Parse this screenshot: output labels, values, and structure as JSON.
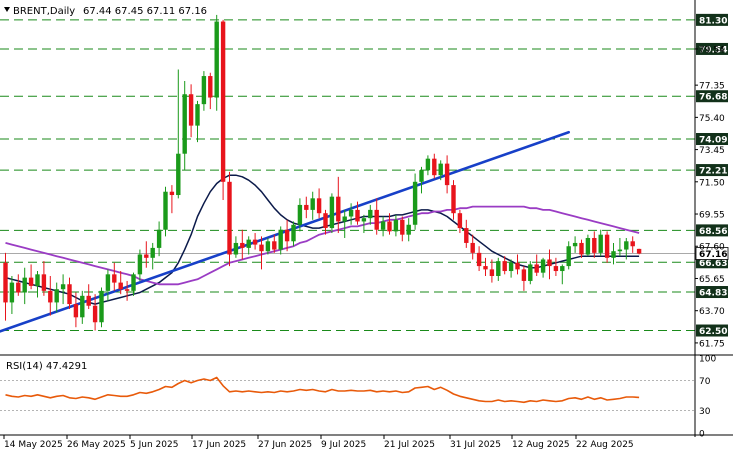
{
  "header": {
    "symbol": "BRENT,Daily",
    "ohlc": "67.44 67.45 67.11 67.16"
  },
  "rsi_header": {
    "label": "RSI(14) 47.4291"
  },
  "colors": {
    "bull": "#1a9a1a",
    "bear": "#e8141c",
    "fast_ma": "#0b1a4a",
    "slow_ma": "#9a3cc4",
    "trendline": "#1740c8",
    "rsi": "#e85a0a",
    "level_line": "#1a8a1a",
    "badge": "#12311a"
  },
  "chart_data": {
    "type": "candlestick",
    "ylim": [
      61.2,
      82.2
    ],
    "price_ticks": [
      "79.54",
      "77.35",
      "75.40",
      "73.45",
      "71.50",
      "69.55",
      "67.60",
      "65.65",
      "63.70",
      "61.75"
    ],
    "level_badges": [
      "81.30",
      "79.54",
      "76.68",
      "74.09",
      "72.21",
      "68.56",
      "66.63",
      "64.83",
      "62.50"
    ],
    "current_price": "67.16",
    "x_labels": [
      "14 May 2025",
      "26 May 2025",
      "5 Jun 2025",
      "17 Jun 2025",
      "27 Jun 2025",
      "9 Jul 2025",
      "21 Jul 2025",
      "31 Jul 2025",
      "12 Aug 2025",
      "22 Aug 2025"
    ],
    "candles": [
      [
        66.6,
        67.2,
        63.1,
        64.2
      ],
      [
        64.2,
        65.8,
        63.5,
        65.4
      ],
      [
        65.4,
        65.9,
        64.6,
        64.8
      ],
      [
        64.8,
        66.3,
        64.1,
        65.7
      ],
      [
        65.7,
        66.5,
        65.0,
        65.2
      ],
      [
        65.2,
        66.1,
        64.5,
        65.9
      ],
      [
        65.9,
        66.7,
        64.6,
        64.9
      ],
      [
        64.9,
        65.8,
        63.4,
        64.2
      ],
      [
        64.2,
        65.4,
        63.6,
        65.0
      ],
      [
        65.0,
        65.9,
        64.1,
        65.3
      ],
      [
        65.3,
        65.7,
        63.8,
        64.1
      ],
      [
        64.1,
        64.8,
        62.7,
        63.3
      ],
      [
        63.3,
        64.9,
        62.9,
        64.6
      ],
      [
        64.6,
        65.3,
        63.8,
        64.0
      ],
      [
        64.0,
        64.7,
        62.5,
        63.0
      ],
      [
        63.0,
        65.1,
        62.7,
        64.9
      ],
      [
        64.9,
        66.2,
        64.3,
        65.9
      ],
      [
        65.9,
        66.6,
        64.9,
        65.4
      ],
      [
        65.4,
        66.1,
        64.7,
        65.0
      ],
      [
        65.0,
        65.5,
        64.3,
        64.9
      ],
      [
        64.9,
        66.0,
        64.6,
        65.9
      ],
      [
        65.9,
        67.4,
        65.5,
        67.1
      ],
      [
        67.1,
        67.9,
        66.3,
        66.9
      ],
      [
        66.9,
        67.8,
        66.2,
        67.5
      ],
      [
        67.5,
        69.1,
        67.0,
        68.6
      ],
      [
        68.6,
        71.2,
        68.2,
        70.9
      ],
      [
        70.9,
        71.3,
        69.6,
        70.7
      ],
      [
        70.7,
        78.3,
        70.5,
        73.2
      ],
      [
        73.2,
        77.6,
        72.2,
        76.8
      ],
      [
        76.8,
        77.4,
        74.2,
        74.9
      ],
      [
        74.9,
        76.4,
        73.9,
        76.2
      ],
      [
        76.2,
        78.2,
        75.8,
        77.9
      ],
      [
        77.9,
        78.1,
        75.9,
        76.6
      ],
      [
        76.6,
        81.6,
        75.8,
        81.2
      ],
      [
        81.2,
        81.3,
        70.4,
        71.5
      ],
      [
        71.5,
        72.1,
        66.4,
        67.1
      ],
      [
        67.1,
        68.2,
        66.9,
        67.8
      ],
      [
        67.8,
        68.6,
        66.8,
        67.5
      ],
      [
        67.5,
        68.2,
        67.1,
        68.0
      ],
      [
        68.0,
        68.4,
        67.4,
        67.7
      ],
      [
        67.7,
        68.2,
        66.2,
        67.3
      ],
      [
        67.3,
        68.1,
        67.1,
        67.9
      ],
      [
        67.9,
        68.3,
        67.2,
        67.4
      ],
      [
        67.4,
        68.8,
        67.1,
        68.6
      ],
      [
        68.6,
        69.2,
        67.3,
        67.9
      ],
      [
        67.9,
        69.1,
        67.6,
        68.9
      ],
      [
        68.9,
        70.5,
        68.5,
        70.1
      ],
      [
        70.1,
        70.6,
        69.3,
        69.8
      ],
      [
        69.8,
        70.9,
        69.2,
        70.5
      ],
      [
        70.5,
        71.1,
        69.3,
        69.6
      ],
      [
        69.6,
        69.8,
        68.3,
        68.7
      ],
      [
        68.7,
        70.8,
        68.4,
        70.6
      ],
      [
        70.6,
        71.8,
        68.4,
        69.1
      ],
      [
        69.1,
        69.8,
        68.1,
        69.4
      ],
      [
        69.4,
        70.2,
        68.9,
        69.8
      ],
      [
        69.8,
        70.3,
        68.9,
        69.1
      ],
      [
        69.1,
        69.5,
        68.4,
        69.3
      ],
      [
        69.3,
        70.1,
        68.9,
        69.8
      ],
      [
        69.8,
        70.5,
        68.3,
        68.6
      ],
      [
        68.6,
        69.4,
        68.2,
        69.1
      ],
      [
        69.1,
        69.6,
        68.3,
        68.5
      ],
      [
        68.5,
        69.5,
        68.2,
        69.2
      ],
      [
        69.2,
        69.4,
        67.9,
        68.3
      ],
      [
        68.3,
        69.3,
        67.9,
        68.9
      ],
      [
        68.9,
        72.0,
        68.6,
        71.5
      ],
      [
        71.5,
        72.4,
        70.8,
        72.2
      ],
      [
        72.2,
        73.1,
        71.9,
        72.9
      ],
      [
        72.9,
        73.2,
        71.7,
        71.9
      ],
      [
        71.9,
        72.8,
        71.6,
        72.6
      ],
      [
        72.6,
        73.1,
        70.8,
        71.3
      ],
      [
        71.3,
        71.6,
        69.2,
        69.6
      ],
      [
        69.6,
        69.8,
        68.4,
        68.7
      ],
      [
        68.7,
        69.2,
        67.5,
        67.8
      ],
      [
        67.8,
        68.3,
        66.8,
        67.2
      ],
      [
        67.2,
        67.6,
        66.1,
        66.4
      ],
      [
        66.4,
        66.9,
        65.8,
        66.2
      ],
      [
        66.2,
        66.8,
        65.4,
        65.8
      ],
      [
        65.8,
        66.9,
        65.5,
        66.7
      ],
      [
        66.7,
        67.0,
        65.9,
        66.1
      ],
      [
        66.1,
        66.8,
        65.7,
        66.6
      ],
      [
        66.6,
        67.1,
        65.9,
        66.2
      ],
      [
        66.2,
        66.4,
        64.9,
        65.5
      ],
      [
        65.5,
        66.7,
        65.3,
        66.5
      ],
      [
        66.5,
        67.1,
        65.8,
        66.0
      ],
      [
        66.0,
        66.9,
        65.7,
        66.8
      ],
      [
        66.8,
        67.4,
        65.6,
        66.4
      ],
      [
        66.4,
        66.9,
        65.8,
        66.1
      ],
      [
        66.1,
        66.5,
        65.3,
        66.4
      ],
      [
        66.4,
        67.9,
        66.2,
        67.6
      ],
      [
        67.6,
        68.2,
        67.2,
        67.8
      ],
      [
        67.8,
        68.0,
        66.9,
        67.1
      ],
      [
        67.1,
        68.3,
        67.0,
        68.1
      ],
      [
        68.1,
        68.5,
        66.9,
        67.2
      ],
      [
        67.2,
        68.6,
        67.0,
        68.3
      ],
      [
        68.3,
        68.5,
        66.6,
        66.9
      ],
      [
        66.9,
        67.8,
        66.5,
        67.3
      ],
      [
        67.3,
        68.1,
        67.0,
        67.4
      ],
      [
        67.4,
        68.1,
        66.8,
        67.9
      ],
      [
        67.9,
        68.2,
        67.2,
        67.6
      ],
      [
        67.44,
        67.45,
        67.11,
        67.16
      ]
    ],
    "fast_ma": [
      65.7,
      65.6,
      65.5,
      65.4,
      65.3,
      65.2,
      65.1,
      65.0,
      64.9,
      64.8,
      64.7,
      64.5,
      64.3,
      64.2,
      64.1,
      64.2,
      64.3,
      64.4,
      64.5,
      64.6,
      64.7,
      64.8,
      65.0,
      65.2,
      65.4,
      65.7,
      66.0,
      66.6,
      67.4,
      68.3,
      69.4,
      70.2,
      70.9,
      71.4,
      71.7,
      71.9,
      71.9,
      71.8,
      71.6,
      71.3,
      70.9,
      70.4,
      69.9,
      69.5,
      69.2,
      69.0,
      68.9,
      68.8,
      68.7,
      68.7,
      68.8,
      68.9,
      69.0,
      69.1,
      69.2,
      69.3,
      69.4,
      69.4,
      69.4,
      69.4,
      69.4,
      69.5,
      69.5,
      69.6,
      69.7,
      69.8,
      69.8,
      69.7,
      69.6,
      69.4,
      69.1,
      68.8,
      68.5,
      68.2,
      67.9,
      67.6,
      67.3,
      67.1,
      66.9,
      66.7,
      66.5,
      66.4,
      66.3,
      66.3,
      66.4,
      66.5,
      66.6,
      66.7,
      66.8,
      66.9,
      67.0,
      67.0,
      67.0,
      67.0,
      67.0,
      67.0,
      67.0,
      67.0,
      67.0,
      67.0
    ],
    "slow_ma": [
      67.8,
      67.7,
      67.6,
      67.5,
      67.4,
      67.3,
      67.2,
      67.1,
      67.0,
      66.9,
      66.8,
      66.7,
      66.6,
      66.5,
      66.4,
      66.3,
      66.2,
      66.1,
      66.0,
      65.9,
      65.8,
      65.6,
      65.5,
      65.4,
      65.3,
      65.3,
      65.3,
      65.3,
      65.4,
      65.5,
      65.6,
      65.8,
      66.0,
      66.2,
      66.4,
      66.6,
      66.7,
      66.8,
      66.9,
      67.0,
      67.1,
      67.2,
      67.3,
      67.4,
      67.5,
      67.6,
      67.8,
      67.9,
      68.1,
      68.3,
      68.4,
      68.5,
      68.6,
      68.7,
      68.8,
      68.8,
      68.9,
      69.0,
      69.0,
      69.1,
      69.2,
      69.2,
      69.3,
      69.4,
      69.5,
      69.6,
      69.6,
      69.7,
      69.7,
      69.8,
      69.8,
      69.9,
      69.9,
      70.0,
      70.0,
      70.0,
      70.0,
      70.0,
      70.0,
      70.0,
      70.0,
      70.0,
      69.9,
      69.9,
      69.8,
      69.8,
      69.7,
      69.6,
      69.5,
      69.4,
      69.3,
      69.2,
      69.1,
      69.0,
      68.9,
      68.8,
      68.7,
      68.6,
      68.5,
      68.4
    ],
    "trendline": [
      [
        -13,
        60.8
      ],
      [
        88,
        74.5
      ]
    ],
    "rsi": {
      "ylim": [
        0,
        100
      ],
      "ticks": [
        "100",
        "70",
        "30",
        "0"
      ],
      "levels": [
        70,
        30
      ],
      "values": [
        51,
        49,
        48,
        50,
        49,
        51,
        49,
        47,
        49,
        50,
        47,
        46,
        48,
        47,
        45,
        48,
        51,
        50,
        49,
        49,
        51,
        54,
        53,
        55,
        58,
        62,
        61,
        66,
        70,
        67,
        70,
        72,
        70,
        74,
        63,
        55,
        56,
        55,
        56,
        55,
        54,
        55,
        54,
        56,
        55,
        56,
        58,
        57,
        58,
        56,
        55,
        58,
        56,
        56,
        57,
        56,
        56,
        57,
        55,
        56,
        55,
        56,
        54,
        55,
        60,
        61,
        62,
        58,
        61,
        57,
        52,
        49,
        47,
        45,
        43,
        42,
        42,
        44,
        42,
        43,
        42,
        41,
        43,
        42,
        44,
        43,
        42,
        43,
        46,
        47,
        45,
        48,
        45,
        47,
        44,
        45,
        46,
        48,
        48,
        47.4
      ]
    }
  }
}
